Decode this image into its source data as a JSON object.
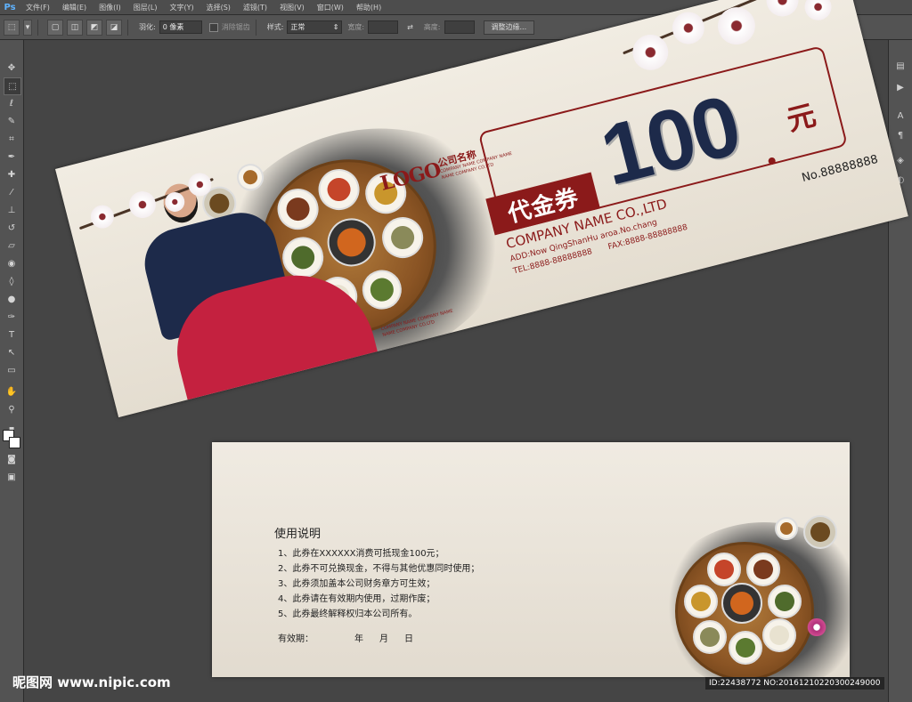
{
  "app": {
    "logo": "Ps",
    "menu": [
      "文件(F)",
      "编辑(E)",
      "图像(I)",
      "图层(L)",
      "文字(Y)",
      "选择(S)",
      "滤镜(T)",
      "视图(V)",
      "窗口(W)",
      "帮助(H)"
    ]
  },
  "options_bar": {
    "feather_label": "羽化:",
    "feather_value": "0 像素",
    "antialias_label": "消除锯齿",
    "style_label": "样式:",
    "style_value": "正常",
    "width_label": "宽度:",
    "height_label": "高度:",
    "refine_button": "调整边缘..."
  },
  "voucher_front": {
    "logo": "LOGO",
    "company_cn": "公司名称",
    "company_en_line1": "COMPANY NAME COMPANY NAME",
    "company_en_line2": "NAME COMPANY CO.LTD",
    "title": "代金券",
    "amount": "100",
    "unit": "元",
    "serial": "No.88888888",
    "company_name": "COMPANY NAME CO.,LTD",
    "address": "ADD:Now QingShanHu aroa.No.chang",
    "tel": "TEL:8888-88888888",
    "fax": "FAX:8888-88888888",
    "bottom_line1": "COMPANY NAME COMPANY NAME",
    "bottom_line2": "NAME COMPANY CO.LTD"
  },
  "voucher_back": {
    "heading": "使用说明",
    "rules": [
      "1、此券在XXXXXX消费可抵现金100元；",
      "2、此券不可兑换现金，不得与其他优惠同时使用；",
      "3、此券须加盖本公司财务章方可生效；",
      "4、此券请在有效期内使用，过期作废；",
      "5、此券最终解释权归本公司所有。"
    ],
    "validity_label": "有效期：",
    "year": "年",
    "month": "月",
    "day": "日"
  },
  "watermark": {
    "site": "昵图网 www.nipic.com",
    "id_text": "ID:22438772 NO:20161210220300249000"
  },
  "colors": {
    "accent_red": "#8b1a1a",
    "navy": "#1d2a4a"
  }
}
